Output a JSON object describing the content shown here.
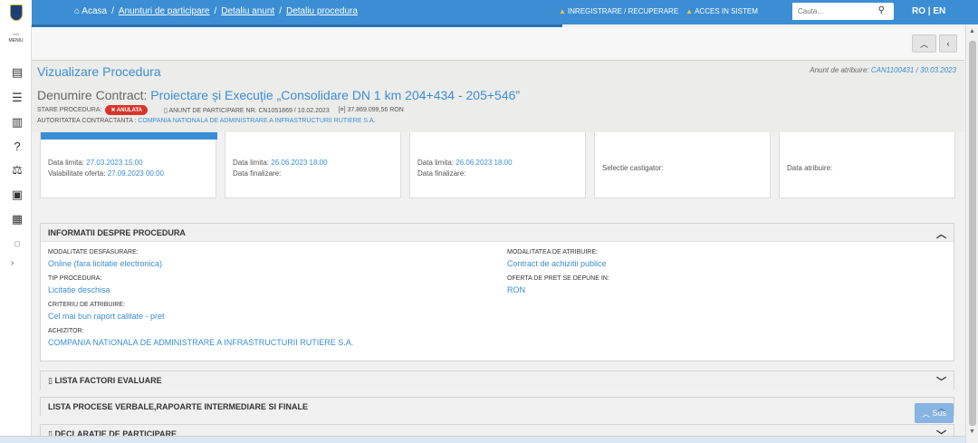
{
  "topbar": {
    "breadcrumb": [
      "Acasa",
      "Anunturi de participare",
      "Detaliu anunt",
      "Detaliu procedura"
    ],
    "links": [
      "INREGISTRARE / RECUPERARE",
      "ACCES IN SISTEM"
    ],
    "search_placeholder": "Cauta...",
    "lang": "RO | EN"
  },
  "sidebar": {
    "menu_label": "MENIU"
  },
  "header": {
    "title": "Vizualizare Procedura",
    "anunt_atribuire_label": "Anunt de atribuire:",
    "anunt_atribuire_value": "CAN1100431 / 30.03.2023",
    "denumire_label": "Denumire Contract:",
    "denumire_value": "Proiectare și Execuție „Consolidare DN 1 km 204+434 - 205+546”",
    "stare_label": "STARE PROCEDURA:",
    "stare_badge": "✖ ANULATA",
    "anunt_participare": "ANUNT DE PARTICIPARE NR. CN1051869 / 10.02.2023",
    "valoare": "37.869.099,56  RON",
    "autoritate_label": "AUTORITATEA CONTRACTANTA :",
    "autoritate_value": "COMPANIA NATIONALA DE ADMINISTRARE A INFRASTRUCTURII RUTIERE S.A."
  },
  "cards": [
    {
      "l1": "Data limita:",
      "v1": "27.03.2023 15:00",
      "l2": "Valabilitate oferta:",
      "v2": "27.09.2023 00:00"
    },
    {
      "l1": "Data limita:",
      "v1": "26.06.2023 18:00",
      "l2": "Data finalizare:",
      "v2": ""
    },
    {
      "l1": "Data limita:",
      "v1": "26.06.2023 18:00",
      "l2": "Data finalizare:",
      "v2": ""
    },
    {
      "l1": "Selectie castigator:",
      "v1": ""
    },
    {
      "l1": "Data atribuire:",
      "v1": ""
    }
  ],
  "info": {
    "title": "INFORMATII DESPRE PROCEDURA",
    "modalitate_label": "MODALITATE DESFASURARE:",
    "modalitate_value": "Online (fara licitatie electronica)",
    "tip_label": "TIP PROCEDURA:",
    "tip_value": "Licitatie deschisa",
    "criteriu_label": "CRITERIU DE ATRIBUIRE:",
    "criteriu_value": "Cel mai bun raport calitate - pret",
    "achizitor_label": "ACHIZITOR:",
    "achizitor_value": "COMPANIA NATIONALA DE ADMINISTRARE A INFRASTRUCTURII RUTIERE S.A.",
    "mod_atr_label": "MODALITATEA DE ATRIBUIRE:",
    "mod_atr_value": "Contract de achizitii publice",
    "oferta_label": "OFERTA DE PRET SE DEPUNE IN:",
    "oferta_value": "RON"
  },
  "panels": {
    "factori": "LISTA FACTORI EVALUARE",
    "procese": "LISTA PROCESE VERBALE,RAPOARTE INTERMEDIARE SI FINALE",
    "declaratie": "DECLARATIE DE PARTICIPARE"
  },
  "sus_label": "Sus",
  "colors": {
    "accent": "#3b8ed4",
    "badge": "#d9342b"
  }
}
